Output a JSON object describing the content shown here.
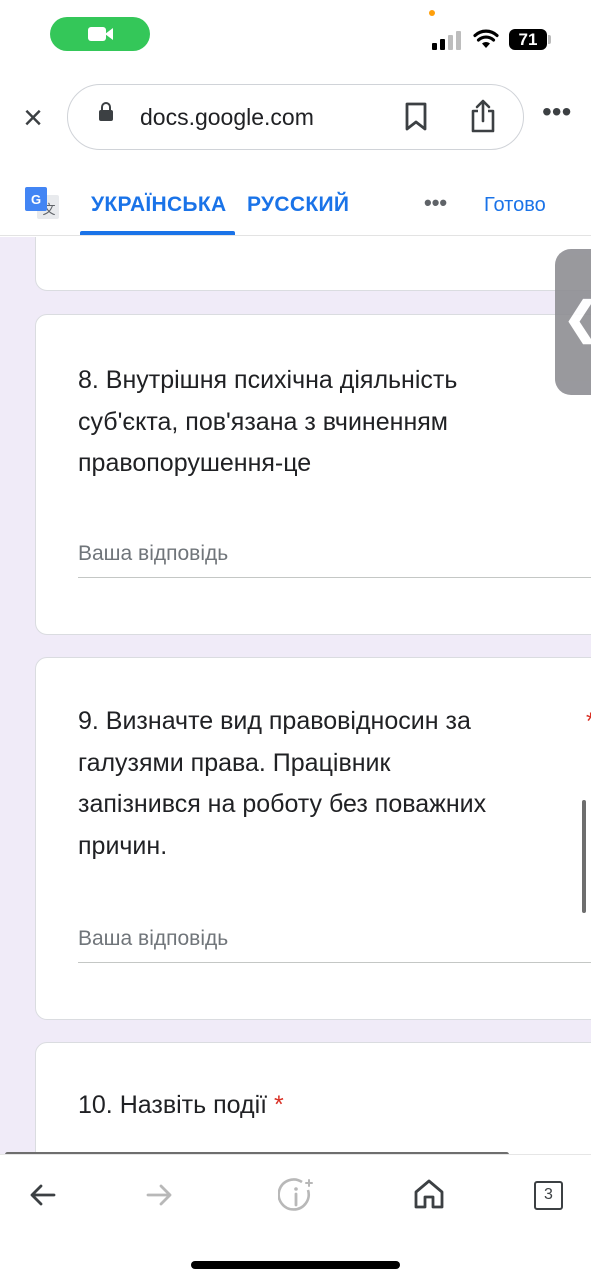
{
  "status_bar": {
    "battery": "71",
    "colors": {
      "facetime_pill": "#34c759",
      "recording_dot": "#ff9f0a"
    }
  },
  "browser": {
    "url": "docs.google.com",
    "icons": [
      "close-icon",
      "lock-icon",
      "bookmark-icon",
      "share-icon",
      "more-icon"
    ]
  },
  "translate_bar": {
    "tab_ukrainian": "УКРАЇНСЬКА",
    "tab_russian": "РУССКИЙ",
    "more": "•••",
    "done": "Готово",
    "accent_color": "#1a73e8"
  },
  "form": {
    "background_color": "#f0ebf8",
    "questions": [
      {
        "lines": [
          "8. Внутрішня психічна діяльність",
          "суб'єкта, пов'язана з вчиненням",
          "правопорушення-це"
        ],
        "placeholder": "Ваша відповідь"
      },
      {
        "lines": [
          "9. Визначте вид правовідносин за",
          "галузями права. Працівник",
          "запізнився на роботу без поважних",
          "причин."
        ],
        "required_mark": "*",
        "placeholder": "Ваша відповідь"
      },
      {
        "lines": [
          "10. Назвіть події"
        ],
        "required_mark": "*"
      }
    ]
  },
  "bottom_bar": {
    "tabs_count": "3",
    "icons": [
      "back-arrow-icon",
      "forward-arrow-icon",
      "page-info-icon",
      "home-icon",
      "tabs-icon"
    ]
  }
}
